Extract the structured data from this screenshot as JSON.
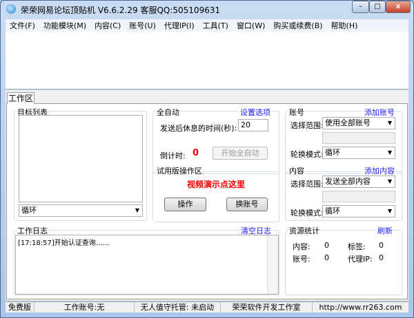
{
  "window": {
    "title": "荣荣网易论坛顶贴机 V6.6.2.29  客服QQ:505109631",
    "min": "–",
    "max": "□",
    "close": "x"
  },
  "menu": [
    "文件(F)",
    "功能模块(M)",
    "内容(C)",
    "账号(U)",
    "代理IP(I)",
    "工具(T)",
    "窗口(W)",
    "购买或续费(B)",
    "帮助(H)"
  ],
  "tab": "工作区",
  "target": {
    "label": "目标列表",
    "mode": "循环"
  },
  "auto": {
    "label": "全自动",
    "link": "设置选项",
    "rest_label": "发送后休息的时间(秒):",
    "rest_value": "20",
    "countdown_label": "倒计时:",
    "countdown": "0",
    "start": "开始全自动"
  },
  "trial": {
    "label": "试用版操作区",
    "video": "视频演示点这里",
    "op": "操作",
    "switch": "换账号"
  },
  "account": {
    "label": "账号",
    "link": "添加账号",
    "range_label": "选择范围:",
    "range": "使用全部账号",
    "mode_label": "轮换模式:",
    "mode": "循环"
  },
  "content": {
    "label": "内容",
    "link": "添加内容",
    "range_label": "选择范围:",
    "range": "发送全部内容",
    "mode_label": "轮换模式:",
    "mode": "循环"
  },
  "log": {
    "label": "工作日志",
    "link": "清空日志",
    "lines": [
      "[17:18:57]开始认证查询……"
    ]
  },
  "stats": {
    "label": "资源统计",
    "link": "刷新",
    "content_label": "内容:",
    "content": "0",
    "tag_label": "标签:",
    "tag": "0",
    "account_label": "账号:",
    "account": "0",
    "proxy_label": "代理IP:",
    "proxy": "0"
  },
  "status": [
    "免费版",
    "工作账号:无",
    "无人值守托管: 未启动",
    "荣荣软件开发工作室",
    "http://www.rr263.com"
  ]
}
